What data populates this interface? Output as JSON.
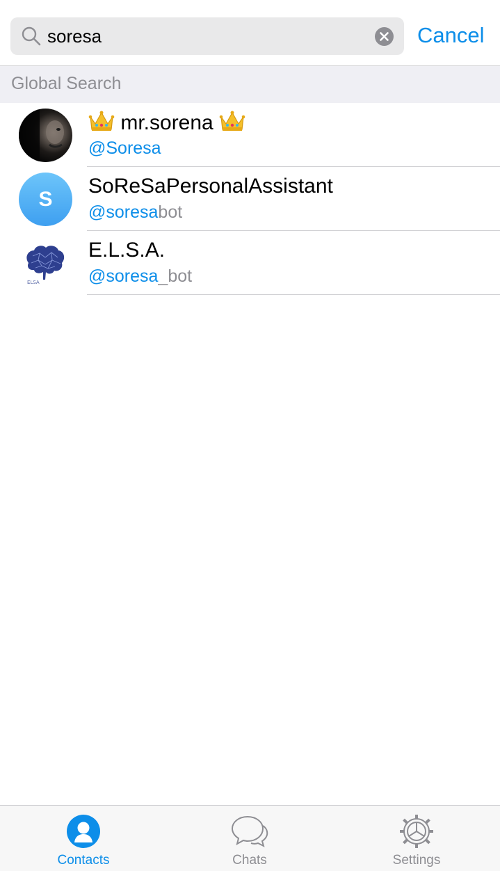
{
  "search": {
    "query": "soresa",
    "cancel_label": "Cancel"
  },
  "section": {
    "title": "Global Search"
  },
  "results": [
    {
      "name": "mr.sorena",
      "name_decoration": "crown-emoji",
      "username_match": "@Soresa",
      "username_rest": "",
      "avatar": "photo"
    },
    {
      "name": "SoReSaPersonalAssistant",
      "username_match": "@soresa",
      "username_rest": "bot",
      "avatar": "letter",
      "avatar_letter": "S"
    },
    {
      "name": "E.L.S.A.",
      "username_match": "@soresa",
      "username_rest": "_bot",
      "avatar": "brain-logo",
      "avatar_logo_text": "ELSA"
    }
  ],
  "tabs": [
    {
      "label": "Contacts",
      "icon": "person-icon",
      "active": true
    },
    {
      "label": "Chats",
      "icon": "speech-bubbles-icon",
      "active": false
    },
    {
      "label": "Settings",
      "icon": "gear-icon",
      "active": false
    }
  ],
  "colors": {
    "accent": "#0d8ee9",
    "secondary_text": "#8e8e93",
    "section_bg": "#efeff4",
    "search_field_bg": "#e9e9ea"
  }
}
